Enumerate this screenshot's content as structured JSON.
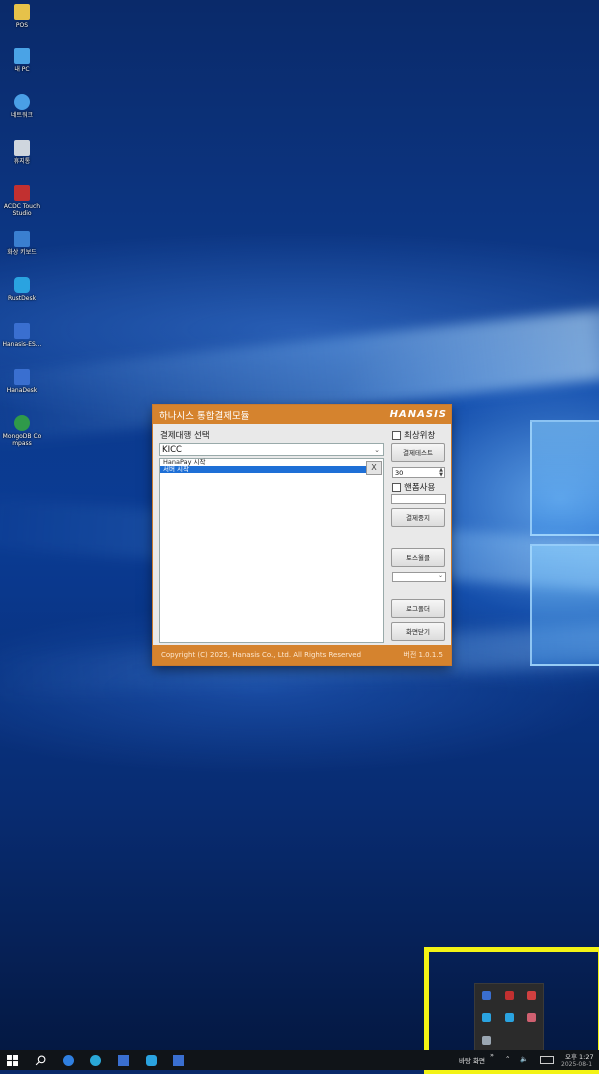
{
  "desktop": {
    "icons": [
      {
        "label": "POS",
        "icon": "folder-icon",
        "color": "#e6c24a"
      },
      {
        "label": "내 PC",
        "icon": "computer-icon",
        "color": "#4aa3e6"
      },
      {
        "label": "네트워크",
        "icon": "network-icon",
        "color": "#4a9fe6"
      },
      {
        "label": "휴지통",
        "icon": "recycle-bin-icon",
        "color": "#cfd6de"
      },
      {
        "label": "ACDC Touch Studio",
        "icon": "acdc-icon",
        "color": "#c23030"
      },
      {
        "label": "화상 키보드",
        "icon": "keyboard-icon",
        "color": "#3a7fd0"
      },
      {
        "label": "RustDesk",
        "icon": "rustdesk-icon",
        "color": "#2aa3e0"
      },
      {
        "label": "Hanasis-ES...",
        "icon": "hanasis-icon",
        "color": "#3a6fd0"
      },
      {
        "label": "HanaDesk",
        "icon": "hanadesk-icon",
        "color": "#3a6fd0"
      },
      {
        "label": "MongoDB Compass",
        "icon": "mongodb-icon",
        "color": "#2f9a4a"
      }
    ]
  },
  "app": {
    "title": "하나시스 통합결제모듈",
    "brand": "HANASIS",
    "select_label": "결제대행 선택",
    "combo_value": "KICC",
    "list_items": [
      "HanaPay 시작",
      "서버 시작"
    ],
    "close_glyph": "X",
    "checkbox_topmost": "최상위창",
    "btn_test": "결제테스트",
    "spin_value": "30",
    "checkbox_feature": "핸폼사용",
    "btn_stop": "결제중지",
    "btn_toss": "토스월클",
    "btn_log": "로그폴더",
    "btn_close": "화면닫기",
    "copyright": "Copyright (C) 2025, Hanasis Co., Ltd. All Rights Reserved",
    "version": "버전 1.0.1.5"
  },
  "taskbar": {
    "desktop_label": "바탕 화면",
    "more": "»",
    "time": "오후 1:27",
    "date": "2025-08-1"
  }
}
